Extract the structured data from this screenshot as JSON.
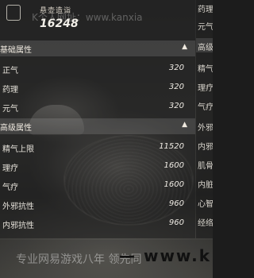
{
  "header": {
    "label": "悬壶造诣",
    "value": "16248"
  },
  "sections": {
    "basic": {
      "title": "基础属性",
      "rows": [
        {
          "label": "正气",
          "value": "320"
        },
        {
          "label": "药理",
          "value": "320"
        },
        {
          "label": "元气",
          "value": "320"
        }
      ]
    },
    "advanced": {
      "title": "高级属性",
      "rows": [
        {
          "label": "精气上限",
          "value": "11520"
        },
        {
          "label": "理疗",
          "value": "1600"
        },
        {
          "label": "气疗",
          "value": "1600"
        },
        {
          "label": "外邪抗性",
          "value": "960"
        },
        {
          "label": "内邪抗性",
          "value": "960"
        }
      ]
    }
  },
  "right_panel": {
    "items": [
      "药理",
      "元气",
      "高级",
      "精气",
      "理疗",
      "气疗",
      "外邪",
      "内邪",
      "肌骨",
      "内脏",
      "心智",
      "经络"
    ]
  },
  "watermark": {
    "top": "K个人网址：www.kanxia",
    "bottom": "专业网易游戏八年 领先同",
    "url": "— www.k"
  }
}
